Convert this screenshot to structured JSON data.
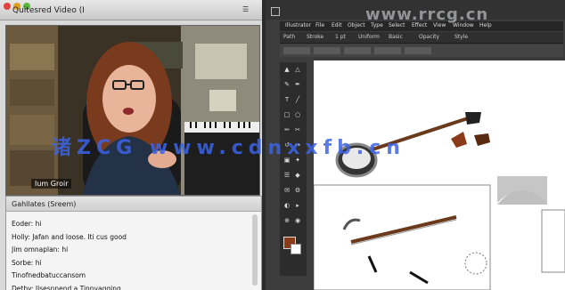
{
  "left_window": {
    "title": "Quitesred Video  (I",
    "menu_icon": "panel-menu-icon",
    "video": {
      "name_tag": "Ium Groir"
    }
  },
  "chat": {
    "title": "Gahllates  (Sreem)",
    "messages": [
      "Eoder: hi",
      "Holly: Jafan and loose. Iti cus good",
      "Jim omnaplan: hi",
      "Sorbe: hi",
      "Tinofnedbatuccansom",
      "Detby: Jlsesnnend a Tinnvagging"
    ]
  },
  "illustrator": {
    "menu": [
      "Illustrator",
      "File",
      "Edit",
      "Object",
      "Type",
      "Select",
      "Effect",
      "View",
      "Window",
      "Help"
    ],
    "control_bar": [
      "Path",
      "Stroke",
      "1 pt",
      "Uniform",
      "Basic",
      "Opacity",
      "Style"
    ],
    "tools_icon": "tool-icon"
  },
  "watermark": {
    "top": "www.rrcg.cn",
    "middle": "诸ZCG  www.cdnxxfb.cn"
  },
  "colors": {
    "panel_bg": "#d9d9d9",
    "app_bg": "#3c3c3c",
    "canvas": "#ffffff",
    "fill_swatch": "#8b3a1a"
  }
}
